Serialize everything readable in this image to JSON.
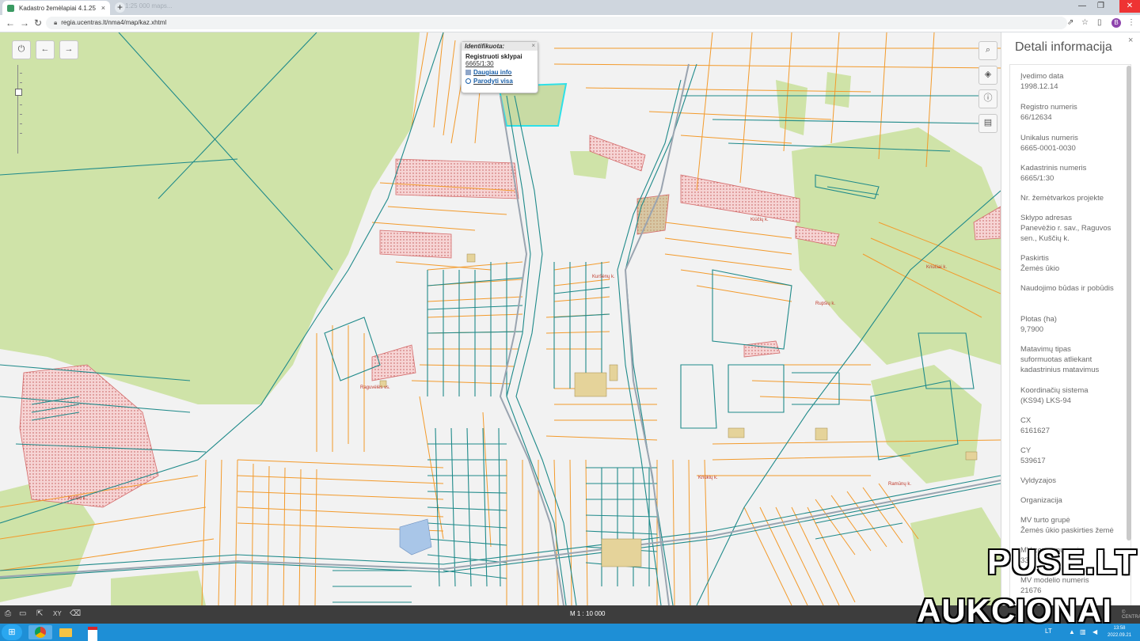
{
  "browser": {
    "tab_title": "Kadastro žemėlapiai 4.1.25",
    "tab_close": "×",
    "new_tab": "+",
    "url": "regia.ucentras.lt/nma4/map/kaz.xhtml",
    "second_tab_hint": "1:25 000 maps..."
  },
  "map": {
    "tools": {
      "power": "⏻",
      "back": "←",
      "forward": "→",
      "search": "⌕",
      "layers": "◈",
      "info": "ⓘ",
      "legend": "▤"
    },
    "popup": {
      "title": "Identifikuota:",
      "close": "×",
      "header": "Registruoti sklypai",
      "parcel": "6665/1:30",
      "more_info": "Daugiau info",
      "show_all": "Parodyti visa"
    },
    "place_labels": [
      {
        "text": "Kiūčių k."
      },
      {
        "text": "Kriūčiai k."
      },
      {
        "text": "Rupšių k."
      },
      {
        "text": "Kuršėnų k."
      },
      {
        "text": "Kriūkių k."
      },
      {
        "text": "Raguvėlės vs."
      },
      {
        "text": "Kuršio k."
      },
      {
        "text": "Ramūnų k."
      }
    ],
    "colors": {
      "parcel_teal": "#1f8a8a",
      "parcel_orange": "#f39a2b",
      "forest_green": "#cfe3a8",
      "selected_cyan": "#2ee0e8",
      "hatch_red": "#d46a6a"
    }
  },
  "status_bar": {
    "scale": "M 1 : 10 000",
    "credit": "© CENTRAS"
  },
  "taskbar": {
    "lang": "LT",
    "time": "13:58",
    "date": "2022.09.21"
  },
  "panel": {
    "title": "Detali informacija",
    "close": "×",
    "fields": [
      {
        "label": "Įvedimo data",
        "value": "1998.12.14"
      },
      {
        "label": "Registro numeris",
        "value": "66/12634"
      },
      {
        "label": "Unikalus numeris",
        "value": "6665-0001-0030"
      },
      {
        "label": "Kadastrinis numeris",
        "value": "6665/1:30"
      },
      {
        "label": "Nr. žemėtvarkos projekte",
        "value": ""
      },
      {
        "label": "Sklypo adresas",
        "value": "Panevėžio r. sav., Raguvos sen., Kuščių k."
      },
      {
        "label": "Paskirtis",
        "value": "Žemės ūkio"
      },
      {
        "label": "Naudojimo būdas ir pobūdis",
        "value": ""
      },
      {
        "label": "Plotas (ha)",
        "value": "9,7900"
      },
      {
        "label": "Matavimų tipas",
        "value": "suformuotas atliekant kadastrinius matavimus"
      },
      {
        "label": "Koordinačių sistema",
        "value": "(KS94) LKS-94"
      },
      {
        "label": "CX",
        "value": "6161627"
      },
      {
        "label": "CY",
        "value": "539617"
      },
      {
        "label": "Vyldyzajos",
        "value": ""
      },
      {
        "label": "Organizacija",
        "value": ""
      },
      {
        "label": "MV turto grupė",
        "value": "Žemės ūkio paskirties žemė"
      },
      {
        "label": "MV zonos numeris",
        "value": "33"
      },
      {
        "label": "MV modelio numeris",
        "value": "21676"
      }
    ]
  },
  "watermark": {
    "line1": "PUSE.LT",
    "line2": "AUKCIONAI"
  }
}
